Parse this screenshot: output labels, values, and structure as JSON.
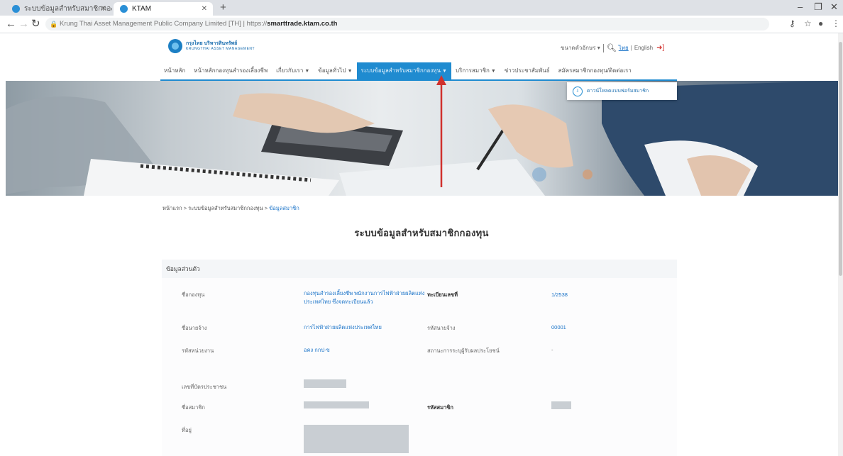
{
  "browser": {
    "tabs": [
      {
        "title": "ระบบข้อมูลสำหรับสมาชิกกองทุน"
      },
      {
        "title": "KTAM"
      }
    ],
    "url_prefix": "Krung Thai Asset Management Public Company Limited [TH]  |  https://",
    "url_host": "smarttrade.ktam.co.th"
  },
  "header": {
    "logo_name_th": "กรุงไทย บริหารสินทรัพย์",
    "logo_name_en": "KRUNGTHAI ASSET MANAGEMENT",
    "font_size_label": "ขนาดตัวอักษร",
    "lang_th": "ไทย",
    "lang_sep": "|",
    "lang_en": "English"
  },
  "menu": {
    "items": [
      {
        "label": "หน้าหลัก",
        "has_dropdown": false
      },
      {
        "label": "หน้าหลักกองทุนสำรองเลี้ยงชีพ",
        "has_dropdown": false
      },
      {
        "label": "เกี่ยวกับเรา",
        "has_dropdown": true
      },
      {
        "label": "ข้อมูลทั่วไป",
        "has_dropdown": true
      },
      {
        "label": "ระบบข้อมูลสำหรับสมาชิกกองทุน",
        "has_dropdown": true,
        "active": true
      },
      {
        "label": "บริการสมาชิก",
        "has_dropdown": true
      },
      {
        "label": "ข่าวประชาสัมพันธ์",
        "has_dropdown": false
      },
      {
        "label": "สมัครสมาชิกกองทุน/ติดต่อเรา",
        "has_dropdown": false
      }
    ],
    "dropdown_item": "ดาวน์โหลดแบบฟอร์มสมาชิก"
  },
  "breadcrumb": {
    "home": "หน้าแรก",
    "section": "ระบบข้อมูลสำหรับสมาชิกกองทุน",
    "current": "ข้อมูลสมาชิก",
    "sep": ">"
  },
  "page": {
    "title": "ระบบข้อมูลสำหรับสมาชิกกองทุน",
    "section_title": "ข้อมูลส่วนตัว"
  },
  "fields": {
    "fund_name_label": "ชื่อกองทุน",
    "fund_name_value": "กองทุนสำรองเลี้ยงชีพ พนักงานการไฟฟ้าฝ่ายผลิตแห่งประเทศไทย ซึ่งจดทะเบียนแล้ว",
    "reg_no_label": "ทะเบียนเลขที่",
    "reg_no_value": "1/2538",
    "employer_label": "ชื่อนายจ้าง",
    "employer_value": "การไฟฟ้าฝ่ายผลิตแห่งประเทศไทย",
    "employer_code_label": "รหัสนายจ้าง",
    "employer_code_value": "00001",
    "dept_code_label": "รหัสหน่วยงาน",
    "dept_code_value": "อคง กกป-ข",
    "beneficiary_label": "สถานะการระบุผู้รับผลประโยชน์",
    "beneficiary_value": "-",
    "citizen_id_label": "เลขที่บัตรประชาชน",
    "member_name_label": "ชื่อสมาชิก",
    "member_code_label": "รหัสสมาชิก",
    "address_label": "ที่อยู่"
  }
}
